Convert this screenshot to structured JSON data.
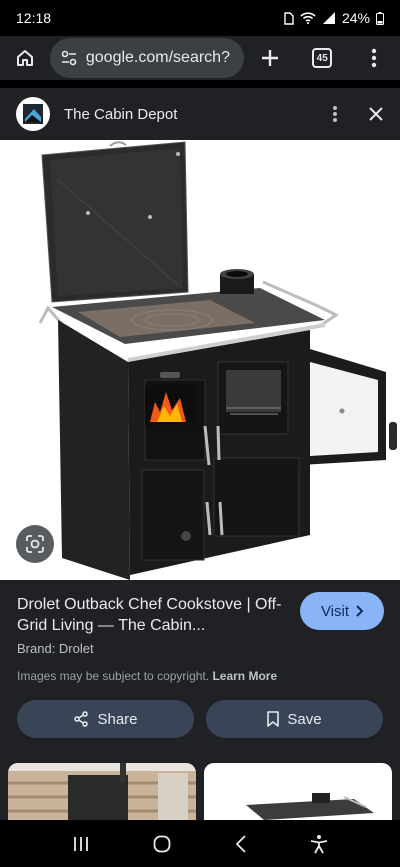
{
  "status": {
    "time": "12:18",
    "battery": "24%"
  },
  "browser": {
    "url": "google.com/search?",
    "tab_count": "45"
  },
  "source": {
    "name": "The Cabin Depot"
  },
  "result": {
    "title": "Drolet Outback Chef Cookstove | Off-Grid Living — The Cabin...",
    "visit_label": "Visit",
    "brand": "Brand: Drolet",
    "copyright_text": "Images may be subject to copyright.",
    "learn_more": "Learn More",
    "share_label": "Share",
    "save_label": "Save"
  },
  "colors": {
    "accent": "#8ab4f8",
    "button_bg": "#394457",
    "surface": "#202124"
  }
}
